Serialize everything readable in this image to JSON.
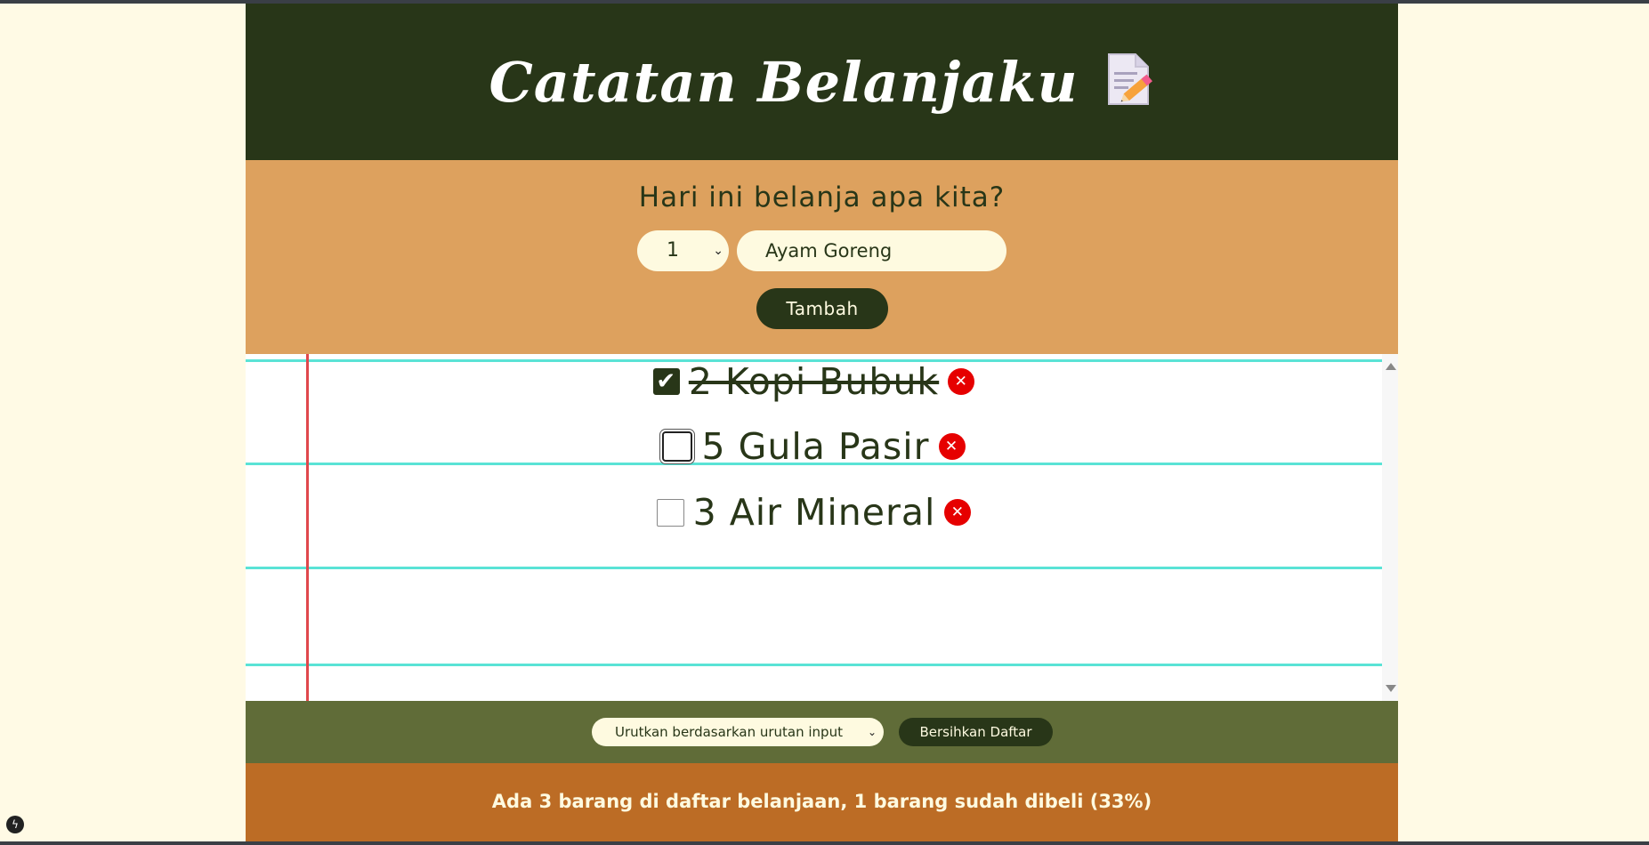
{
  "header": {
    "title": "Catatan Belanjaku",
    "icon": "memo-icon"
  },
  "form": {
    "question": "Hari ini belanja apa kita?",
    "quantity_value": "1",
    "item_value": "Ayam Goreng",
    "add_label": "Tambah"
  },
  "list": {
    "items": [
      {
        "text": "2 Kopi Bubuk",
        "checked": true
      },
      {
        "text": "5 Gula Pasir",
        "checked": false
      },
      {
        "text": "3 Air Mineral",
        "checked": false
      }
    ],
    "delete_symbol": "✕"
  },
  "actions": {
    "sort_value": "Urutkan berdasarkan urutan input",
    "clear_label": "Bersihkan Daftar"
  },
  "stats": {
    "text": "Ada 3 barang di daftar belanjaan, 1 barang sudah dibeli (33%)",
    "total": 3,
    "bought": 1,
    "percent": 33
  },
  "colors": {
    "dark_green": "#283618",
    "tan": "#dda15e",
    "olive": "#606c38",
    "rust": "#bc6c25",
    "cream": "#fefae0",
    "delete_red": "#e60000"
  }
}
